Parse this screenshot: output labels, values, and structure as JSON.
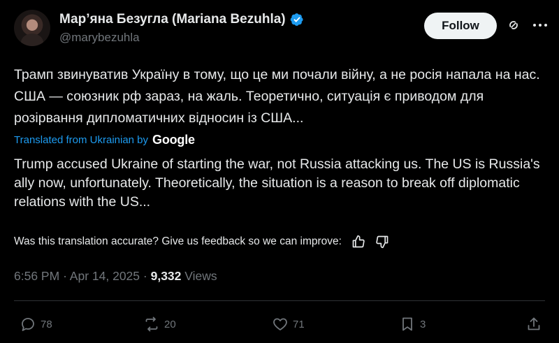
{
  "author": {
    "display_name": "Мар’яна Безугла (Mariana Bezuhla)",
    "handle": "@marybezuhla",
    "verified": true
  },
  "header": {
    "follow_label": "Follow",
    "more_icon": "more-horizontal-icon",
    "grok_icon": "grok-icon"
  },
  "tweet": {
    "text": "Трамп звинуватив Україну в тому, що це ми почали війну, а не росія напала на нас. США — союзник рф зараз, на жаль. Теоретично, ситуація є приводом для розірвання дипломатичних відносин із США...",
    "translated_label": "Translated from Ukrainian by",
    "translator_brand": "Google",
    "translation": "Trump accused Ukraine of starting the war, not Russia attacking us. The US is Russia's ally now, unfortunately. Theoretically, the situation is a reason to break off diplomatic relations with the US...",
    "feedback_prompt": "Was this translation accurate? Give us feedback so we can improve:"
  },
  "meta": {
    "time": "6:56 PM",
    "separator": "·",
    "date": "Apr 14, 2025",
    "views_count": "9,332",
    "views_label": "Views"
  },
  "actions": {
    "replies": "78",
    "reposts": "20",
    "likes": "71",
    "bookmarks": "3"
  },
  "colors": {
    "background": "#000000",
    "text": "#e7e9ea",
    "secondary": "#71767b",
    "link": "#1d9bf0",
    "verified": "#1d9bf0",
    "divider": "#2f3336"
  }
}
